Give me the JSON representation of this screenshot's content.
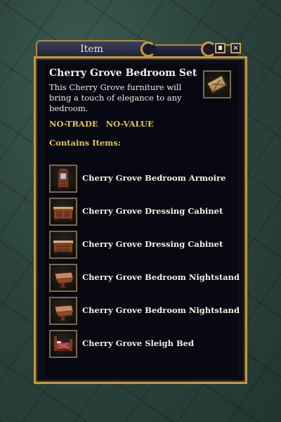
{
  "window": {
    "title": "Item",
    "buttons": {
      "minimize_icon": "minimize-icon",
      "close_label": "×"
    }
  },
  "item": {
    "name": "Cherry Grove Bedroom Set",
    "description": "This Cherry Grove furniture will bring a touch of elegance to any bedroom.",
    "flags": [
      "NO-TRADE",
      "NO-VALUE"
    ],
    "icon": "bedroom-set-crate-icon"
  },
  "contains": {
    "header": "Contains Items:",
    "items": [
      {
        "label": "Cherry Grove Bedroom Armoire",
        "icon": "armoire-icon"
      },
      {
        "label": "Cherry Grove Dressing Cabinet",
        "icon": "dressing-cabinet-icon"
      },
      {
        "label": "Cherry Grove Dressing Cabinet",
        "icon": "dressing-cabinet-icon"
      },
      {
        "label": "Cherry Grove Bedroom Nightstand",
        "icon": "nightstand-icon"
      },
      {
        "label": "Cherry Grove Bedroom Nightstand",
        "icon": "nightstand-icon"
      },
      {
        "label": "Cherry Grove Sleigh Bed",
        "icon": "sleigh-bed-icon"
      }
    ]
  },
  "colors": {
    "title_text": "#e8e2d0",
    "name_text": "#f4f0e6",
    "flag_text": "#e6c74a",
    "border_gold": "#c39a45"
  }
}
